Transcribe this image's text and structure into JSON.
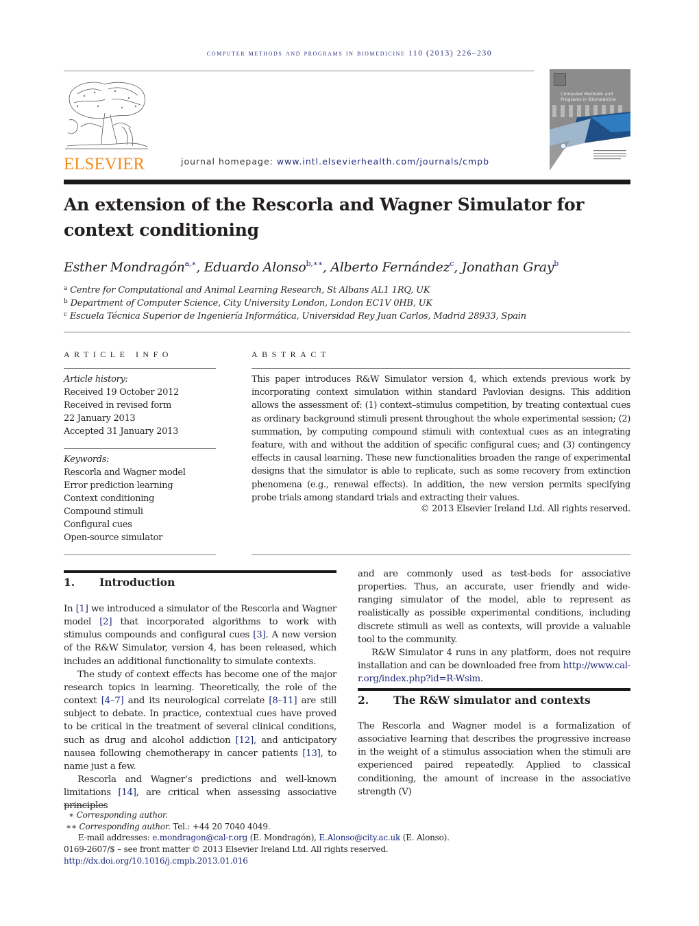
{
  "header": {
    "running_head": "computer methods and programs in biomedicine 110 (2013) 226–230",
    "publisher": "ELSEVIER",
    "homepage_label": "journal homepage: ",
    "homepage_url": "www.intl.elsevierhealth.com/journals/cmpb",
    "cover_title_line1": "Computer Methods and",
    "cover_title_line2": "Programs in Biomedicine"
  },
  "article": {
    "title_line1": "An extension of the Rescorla and Wagner Simulator for",
    "title_line2": "context conditioning",
    "authors": [
      {
        "name": "Esther Mondragón",
        "sup": "a,∗"
      },
      {
        "name": "Eduardo Alonso",
        "sup": "b,∗∗"
      },
      {
        "name": "Alberto Fernández",
        "sup": "c"
      },
      {
        "name": "Jonathan Gray",
        "sup": "b"
      }
    ],
    "separator": ", ",
    "affiliations": [
      {
        "key": "a",
        "text": "Centre for Computational and Animal Learning Research, St Albans AL1 1RQ, UK"
      },
      {
        "key": "b",
        "text": "Department of Computer Science, City University London, London EC1V 0HB, UK"
      },
      {
        "key": "c",
        "text": "Escuela Técnica Superior de Ingeniería Informática, Universidad Rey Juan Carlos, Madrid 28933, Spain"
      }
    ]
  },
  "article_info": {
    "label": "ARTICLE INFO",
    "history_label": "Article history:",
    "history": [
      "Received 19 October 2012",
      "Received in revised form",
      "22 January 2013",
      "Accepted 31 January 2013"
    ],
    "keywords_label": "Keywords:",
    "keywords": [
      "Rescorla and Wagner model",
      "Error prediction learning",
      "Context conditioning",
      "Compound stimuli",
      "Configural cues",
      "Open-source simulator"
    ]
  },
  "abstract": {
    "label": "ABSTRACT",
    "text": "This paper introduces R&W Simulator version 4, which extends previous work by incorporating context simulation within standard Pavlovian designs. This addition allows the assessment of: (1) context–stimulus competition, by treating contextual cues as ordinary background stimuli present throughout the whole experimental session; (2) summation, by computing compound stimuli with contextual cues as an integrating feature, with and without the addition of specific configural cues; and (3) contingency effects in causal learning. These new functionalities broaden the range of experimental designs that the simulator is able to replicate, such as some recovery from extinction phenomena (e.g., renewal effects). In addition, the new version permits specifying probe trials among standard trials and extracting their values.",
    "copyright": "© 2013 Elsevier Ireland Ltd. All rights reserved."
  },
  "sections": {
    "intro": {
      "number": "1.",
      "title": "Introduction",
      "p1": [
        {
          "t": "In "
        },
        {
          "ref": "[1]"
        },
        {
          "t": " we introduced a simulator of the Rescorla and Wagner model "
        },
        {
          "ref": "[2]"
        },
        {
          "t": " that incorporated algorithms to work with stimulus compounds and configural cues "
        },
        {
          "ref": "[3]"
        },
        {
          "t": ". A new version of the R&W Simulator, version 4, has been released, which includes an additional functionality to simulate contexts."
        }
      ],
      "p2": [
        {
          "t": "The study of context effects has become one of the major research topics in learning. Theoretically, the role of the context "
        },
        {
          "ref": "[4–7]"
        },
        {
          "t": " and its neurological correlate "
        },
        {
          "ref": "[8–11]"
        },
        {
          "t": " are still subject to debate. In practice, contextual cues have proved to be critical in the treatment of several clinical conditions, such as drug and alcohol addiction "
        },
        {
          "ref": "[12]"
        },
        {
          "t": ", and anticipatory nausea following chemotherapy in cancer patients "
        },
        {
          "ref": "[13]"
        },
        {
          "t": ", to name just a few."
        }
      ],
      "p3": [
        {
          "t": "Rescorla and Wagner’s predictions and well-known limitations "
        },
        {
          "ref": "[14]"
        },
        {
          "t": ", are critical when assessing associative principles"
        }
      ]
    },
    "right_col": {
      "p1": "and are commonly used as test-beds for associative properties. Thus, an accurate, user friendly and wide-ranging simulator of the model, able to represent as realistically as possible experimental conditions, including discrete stimuli as well as contexts, will provide a valuable tool to the community.",
      "p2_text": "R&W Simulator 4 runs in any platform, does not require installation and can be downloaded free from ",
      "p2_link": "http://www.cal-r.org/index.php?id=R-Wsim",
      "p2_end": "."
    },
    "sec2": {
      "number": "2.",
      "title": "The R&W simulator and contexts",
      "p1": "The Rescorla and Wagner model is a formalization of associative learning that describes the progressive increase in the weight of a stimulus association when the stimuli are experienced paired repeatedly. Applied to classical conditioning, the amount of increase in the associative strength (V)"
    }
  },
  "footnotes": {
    "fn1_mark": "∗",
    "fn1_text": "Corresponding author.",
    "fn2_mark": "∗∗",
    "fn2_text": "Corresponding author.",
    "fn2_tel": " Tel.: +44 20 7040 4049.",
    "email_label": "E-mail addresses: ",
    "email1": "e.mondragon@cal-r.org",
    "email1_name": " (E. Mondragón), ",
    "email2": "E.Alonso@city.ac.uk",
    "email2_name": " (E. Alonso).",
    "issn": "0169-2607/$ – see front matter © 2013 Elsevier Ireland Ltd. All rights reserved.",
    "doi": "http://dx.doi.org/10.1016/j.cmpb.2013.01.016"
  },
  "colors": {
    "link": "#1f2a7a",
    "elsevier_orange": "#f28c1c",
    "text": "#231f20"
  }
}
